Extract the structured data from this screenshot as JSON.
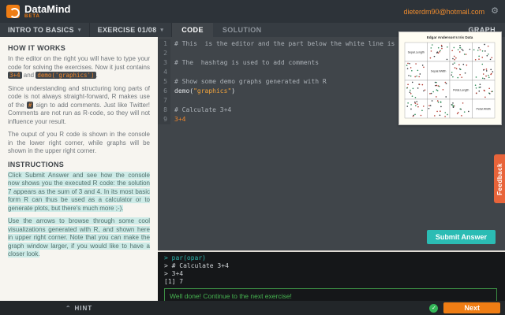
{
  "topbar": {
    "app_name": "DataMind",
    "beta": "BETA",
    "account": "dieterdm90@hotmail.com"
  },
  "icons": {
    "gear": "⚙",
    "chevron_down": "▾",
    "hint_caret": "⌃",
    "check": "✓"
  },
  "nav": {
    "course": "INTRO TO BASICS",
    "exercise": "EXERCISE 01/08",
    "tab_code": "CODE",
    "tab_solution": "SOLUTION",
    "graph_label": "GRAPH"
  },
  "sidebar": {
    "how_it_works": {
      "heading": "HOW IT WORKS",
      "p1a": "In the editor on the right you will have to type your code for solving the exercises. Now it just contains ",
      "p1code1": "3+4",
      "p1b": " and ",
      "p1code2": "demo('graphics')",
      "p1c": ".",
      "p2a": "Since understanding and structuring long parts of code is not always straight-forward, R makes use of the ",
      "p2code1": "#",
      "p2b": " sign to add comments. Just like Twitter! Comments are not run as R-code, so they will not influence your result.",
      "p3": "The ouput of you R code is shown in the console in the lower right corner, while graphs will be shown in the upper right corner."
    },
    "instructions": {
      "heading": "INSTRUCTIONS",
      "p1": "Click Submit Answer and see how the console now shows you the executed R code: the solution 7 appears as the sum of 3 and 4. In its most basic form R can thus be used as a calculator or to generate plots, but there's much more ;-).",
      "p2": "Use the arrows to browse through some cool visualizations generated with R, and shown here in upper right corner. Note that you can make the graph window larger, if you would like to have a closer look."
    },
    "hint_label": "HINT"
  },
  "editor": {
    "lines": [
      {
        "num": "1",
        "segments": [
          {
            "t": "# This  is the editor and the part below the white line is called the console.",
            "c": "comment"
          }
        ]
      },
      {
        "num": "2",
        "segments": []
      },
      {
        "num": "3",
        "segments": [
          {
            "t": "# The  hashtag is used to add comments",
            "c": "comment"
          }
        ]
      },
      {
        "num": "4",
        "segments": []
      },
      {
        "num": "5",
        "segments": [
          {
            "t": "# Show some demo graphs generated with R",
            "c": "comment"
          }
        ]
      },
      {
        "num": "6",
        "segments": [
          {
            "t": "demo(",
            "c": "plain"
          },
          {
            "t": "\"graphics\"",
            "c": "string"
          },
          {
            "t": ")",
            "c": "plain"
          }
        ]
      },
      {
        "num": "7",
        "segments": []
      },
      {
        "num": "8",
        "segments": [
          {
            "t": "# Calculate 3+4",
            "c": "comment"
          }
        ]
      },
      {
        "num": "9",
        "segments": [
          {
            "t": "3+4",
            "c": "number"
          }
        ]
      }
    ],
    "submit_label": "Submit Answer"
  },
  "graph": {
    "title": "Edgar Anderson's Iris Data",
    "vars": [
      "Sepal.Length",
      "Sepal.Width",
      "Petal.Length",
      "Petal.Width"
    ],
    "point_colors": [
      "#b23a2f",
      "#2e8b57",
      "#33383c"
    ]
  },
  "feedback": {
    "label": "Feedback"
  },
  "console": {
    "lines": [
      {
        "t": "> par(opar)",
        "c": "teal"
      },
      {
        "t": "> # Calculate 3+4",
        "c": "plain"
      },
      {
        "t": "> 3+4",
        "c": "plain"
      },
      {
        "t": "[1] 7",
        "c": "plain"
      }
    ],
    "success": "Well done! Continue to the next exercise!",
    "prompt": ">"
  },
  "footer": {
    "next_label": "Next"
  },
  "colors": {
    "accent_orange": "#ef7d14",
    "teal": "#2bbcb4",
    "success_green": "#46b450"
  }
}
